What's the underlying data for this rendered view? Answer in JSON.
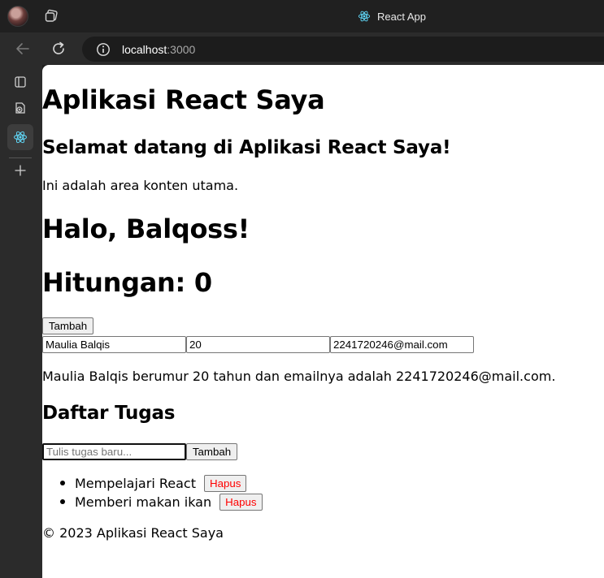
{
  "browser": {
    "tab_title": "React App",
    "address": {
      "host": "localhost",
      "port": ":3000"
    }
  },
  "page": {
    "app_title": "Aplikasi React Saya",
    "welcome": "Selamat datang di Aplikasi React Saya!",
    "content_text": "Ini adalah area konten utama.",
    "greeting": "Halo, Balqoss!",
    "counter_label": "Hitungan: 0",
    "add_counter_button": "Tambah",
    "form": {
      "name_value": "Maulia Balqis",
      "age_value": "20",
      "email_value": "2241720246@mail.com"
    },
    "summary": "Maulia Balqis berumur 20 tahun dan emailnya adalah 2241720246@mail.com.",
    "todo": {
      "title": "Daftar Tugas",
      "input_placeholder": "Tulis tugas baru...",
      "add_button": "Tambah",
      "delete_label": "Hapus",
      "items": [
        {
          "label": "Mempelajari React"
        },
        {
          "label": "Memberi makan ikan"
        }
      ]
    },
    "footer": "© 2023 Aplikasi React Saya"
  },
  "colors": {
    "delete_button_text": "#ff0000",
    "react_logo": "#61dafb"
  }
}
